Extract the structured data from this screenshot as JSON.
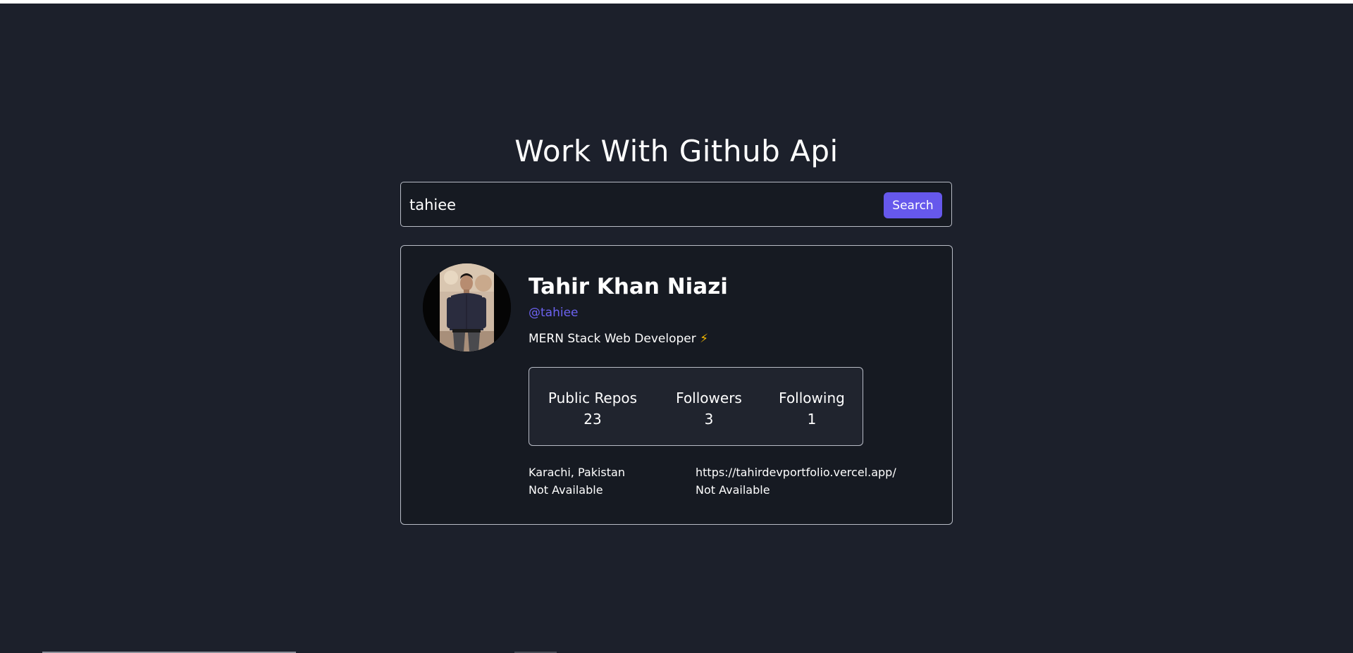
{
  "header": {
    "title": "Work With Github Api"
  },
  "search": {
    "value": "tahiee",
    "button_label": "Search"
  },
  "profile": {
    "name": "Tahir Khan Niazi",
    "username": "@tahiee",
    "bio": "MERN Stack Web Developer",
    "bio_emoji": "⚡",
    "avatar_icon": "user-avatar-photo",
    "stats": [
      {
        "label": "Public Repos",
        "value": "23"
      },
      {
        "label": "Followers",
        "value": "3"
      },
      {
        "label": "Following",
        "value": "1"
      }
    ],
    "location": "Karachi, Pakistan",
    "blog": "https://tahirdevportfolio.vercel.app/",
    "twitter": "Not Available",
    "company": "Not Available"
  },
  "colors": {
    "background": "#1c202b",
    "card": "#161a22",
    "accent": "#6658ec",
    "username": "#6c62f0"
  }
}
